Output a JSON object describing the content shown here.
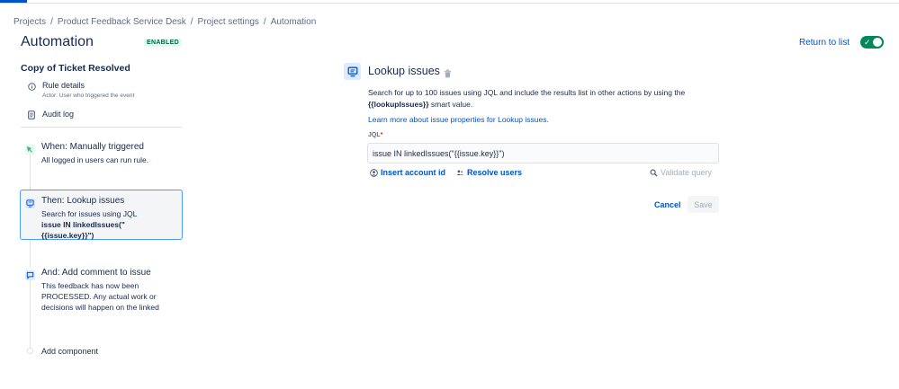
{
  "breadcrumb": [
    "Projects",
    "Product Feedback Service Desk",
    "Project settings",
    "Automation"
  ],
  "breadcrumb_separator": "/",
  "page_title": "Automation",
  "status_badge": "ENABLED",
  "return_link": "Return to list",
  "toggle": {
    "enabled": true,
    "icon": "check-icon"
  },
  "sidebar": {
    "rule_name": "Copy of Ticket Resolved",
    "rule_details": {
      "label": "Rule details",
      "sub": "Actor: User who triggered the event",
      "icon": "info-icon"
    },
    "audit_log": {
      "label": "Audit log",
      "icon": "document-icon"
    },
    "steps": [
      {
        "title": "When: Manually triggered",
        "desc": "All logged in users can run rule.",
        "icon": "trigger-icon",
        "color": "#36b37e"
      },
      {
        "title": "Then: Lookup issues",
        "desc_line1": "Search for issues using JQL",
        "desc_line2": "issue IN linkedIssues(\"",
        "desc_line3": "{{issue.key}}\")",
        "icon": "lookup-icon",
        "color": "#0052cc"
      },
      {
        "title": "And: Add comment to issue",
        "desc": "This feedback has now been PROCESSED. Any actual work or decisions will happen on the linked",
        "icon": "comment-icon",
        "color": "#0052cc"
      }
    ],
    "add_component": "Add component"
  },
  "panel": {
    "title": "Lookup issues",
    "desc_part1": "Search for up to 100 issues using JQL and include the results list in other actions by using the",
    "desc_smart": "{{lookupIssues}}",
    "desc_part2": " smart value.",
    "learn_link": "Learn more about issue properties for Lookup issues.",
    "jql_label": "JQL",
    "jql_required": "*",
    "jql_value": "issue IN linkedIssues(\"{{issue.key}}\")",
    "insert_account": "Insert account id",
    "resolve_users": "Resolve users",
    "validate_query": "Validate query",
    "cancel": "Cancel",
    "save": "Save"
  },
  "colors": {
    "accent": "#0052cc",
    "enabled": "#00875a",
    "selected_border": "#4c9aff"
  }
}
